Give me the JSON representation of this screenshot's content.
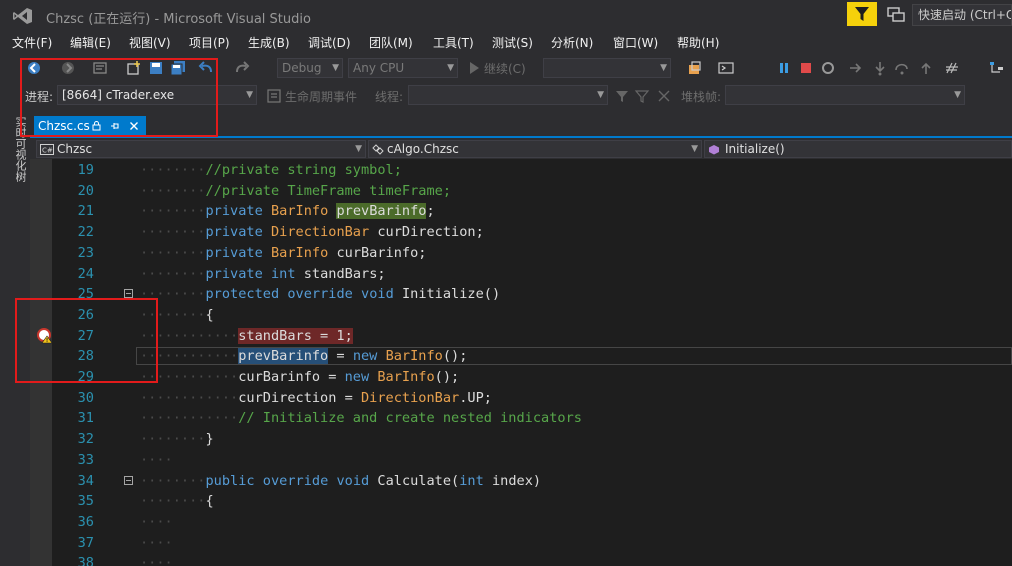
{
  "window": {
    "title": "Chzsc (正在运行) - Microsoft Visual Studio",
    "quick_launch_placeholder": "快速启动 (Ctrl+Q)"
  },
  "menu": [
    "文件(F)",
    "编辑(E)",
    "视图(V)",
    "项目(P)",
    "生成(B)",
    "调试(D)",
    "团队(M)",
    "工具(T)",
    "测试(S)",
    "分析(N)",
    "窗口(W)",
    "帮助(H)"
  ],
  "toolbar": {
    "config": "Debug",
    "platform": "Any CPU",
    "continue_label": "继续(C)"
  },
  "debug_location": {
    "process_label": "进程:",
    "process_value": "[8664] cTrader.exe",
    "lifecycle_label": "生命周期事件",
    "thread_label": "线程:",
    "stack_frame_label": "堆栈帧:"
  },
  "side_panel": {
    "label": "实时可视化树"
  },
  "tabs": [
    {
      "label": "Chzsc.cs",
      "active": true
    }
  ],
  "nav": {
    "project": "Chzsc",
    "class": "cAlgo.Chzsc",
    "member": "Initialize()"
  },
  "code_lines": [
    {
      "n": "19",
      "indent": 2,
      "tokens": [
        {
          "t": "//private string symbol;",
          "c": "cm"
        }
      ]
    },
    {
      "n": "20",
      "indent": 2,
      "tokens": [
        {
          "t": "//private TimeFrame timeFrame;",
          "c": "cm"
        }
      ]
    },
    {
      "n": "21",
      "indent": 2,
      "tokens": [
        {
          "t": "private",
          "c": "kw"
        },
        {
          "t": " "
        },
        {
          "t": "BarInfo",
          "c": "ty"
        },
        {
          "t": " "
        },
        {
          "t": "prevBarinfo",
          "c": "id",
          "hl": "green"
        },
        {
          "t": ";"
        }
      ]
    },
    {
      "n": "22",
      "indent": 2,
      "tokens": [
        {
          "t": "private",
          "c": "kw"
        },
        {
          "t": " "
        },
        {
          "t": "DirectionBar",
          "c": "ty"
        },
        {
          "t": " curDirection;"
        }
      ]
    },
    {
      "n": "23",
      "indent": 2,
      "tokens": [
        {
          "t": "private",
          "c": "kw"
        },
        {
          "t": " "
        },
        {
          "t": "BarInfo",
          "c": "ty"
        },
        {
          "t": " curBarinfo;"
        }
      ]
    },
    {
      "n": "24",
      "indent": 2,
      "tokens": [
        {
          "t": "private",
          "c": "kw"
        },
        {
          "t": " "
        },
        {
          "t": "int",
          "c": "kw"
        },
        {
          "t": " standBars;"
        }
      ]
    },
    {
      "n": "25",
      "indent": 2,
      "fold": true,
      "tokens": [
        {
          "t": "protected",
          "c": "kw"
        },
        {
          "t": " "
        },
        {
          "t": "override",
          "c": "kw"
        },
        {
          "t": " "
        },
        {
          "t": "void",
          "c": "kw"
        },
        {
          "t": " Initialize()"
        }
      ]
    },
    {
      "n": "26",
      "indent": 2,
      "tokens": [
        {
          "t": "{"
        }
      ]
    },
    {
      "n": "27",
      "indent": 3,
      "breakpoint": true,
      "tokens": [
        {
          "t": "standBars = 1;",
          "c": "id",
          "hl": "red"
        }
      ]
    },
    {
      "n": "28",
      "indent": 3,
      "current": true,
      "tokens": [
        {
          "t": "prevBarinfo",
          "c": "id",
          "hl": "sel"
        },
        {
          "t": " = "
        },
        {
          "t": "new",
          "c": "kw"
        },
        {
          "t": " "
        },
        {
          "t": "BarInfo",
          "c": "ty"
        },
        {
          "t": "();"
        }
      ]
    },
    {
      "n": "29",
      "indent": 3,
      "tokens": [
        {
          "t": "curBarinfo = "
        },
        {
          "t": "new",
          "c": "kw"
        },
        {
          "t": " "
        },
        {
          "t": "BarInfo",
          "c": "ty"
        },
        {
          "t": "();"
        }
      ]
    },
    {
      "n": "30",
      "indent": 3,
      "tokens": [
        {
          "t": "curDirection = "
        },
        {
          "t": "DirectionBar",
          "c": "ty"
        },
        {
          "t": ".UP;"
        }
      ]
    },
    {
      "n": "31",
      "indent": 3,
      "tokens": [
        {
          "t": "// Initialize and create nested indicators",
          "c": "cm"
        }
      ]
    },
    {
      "n": "32",
      "indent": 2,
      "tokens": [
        {
          "t": "}"
        }
      ]
    },
    {
      "n": "33",
      "indent": 0,
      "tokens": []
    },
    {
      "n": "34",
      "indent": 2,
      "fold": true,
      "tokens": [
        {
          "t": "public",
          "c": "kw"
        },
        {
          "t": " "
        },
        {
          "t": "override",
          "c": "kw"
        },
        {
          "t": " "
        },
        {
          "t": "void",
          "c": "kw"
        },
        {
          "t": " Calculate("
        },
        {
          "t": "int",
          "c": "kw"
        },
        {
          "t": " index)"
        }
      ]
    },
    {
      "n": "35",
      "indent": 2,
      "tokens": [
        {
          "t": "{"
        }
      ]
    },
    {
      "n": "36",
      "indent": 0,
      "tokens": []
    },
    {
      "n": "37",
      "indent": 0,
      "tokens": []
    },
    {
      "n": "38",
      "indent": 0,
      "tokens": []
    }
  ],
  "colors": {
    "accent": "#007acc",
    "annotation": "#e21b1b",
    "filter_button": "#f5d10b"
  }
}
